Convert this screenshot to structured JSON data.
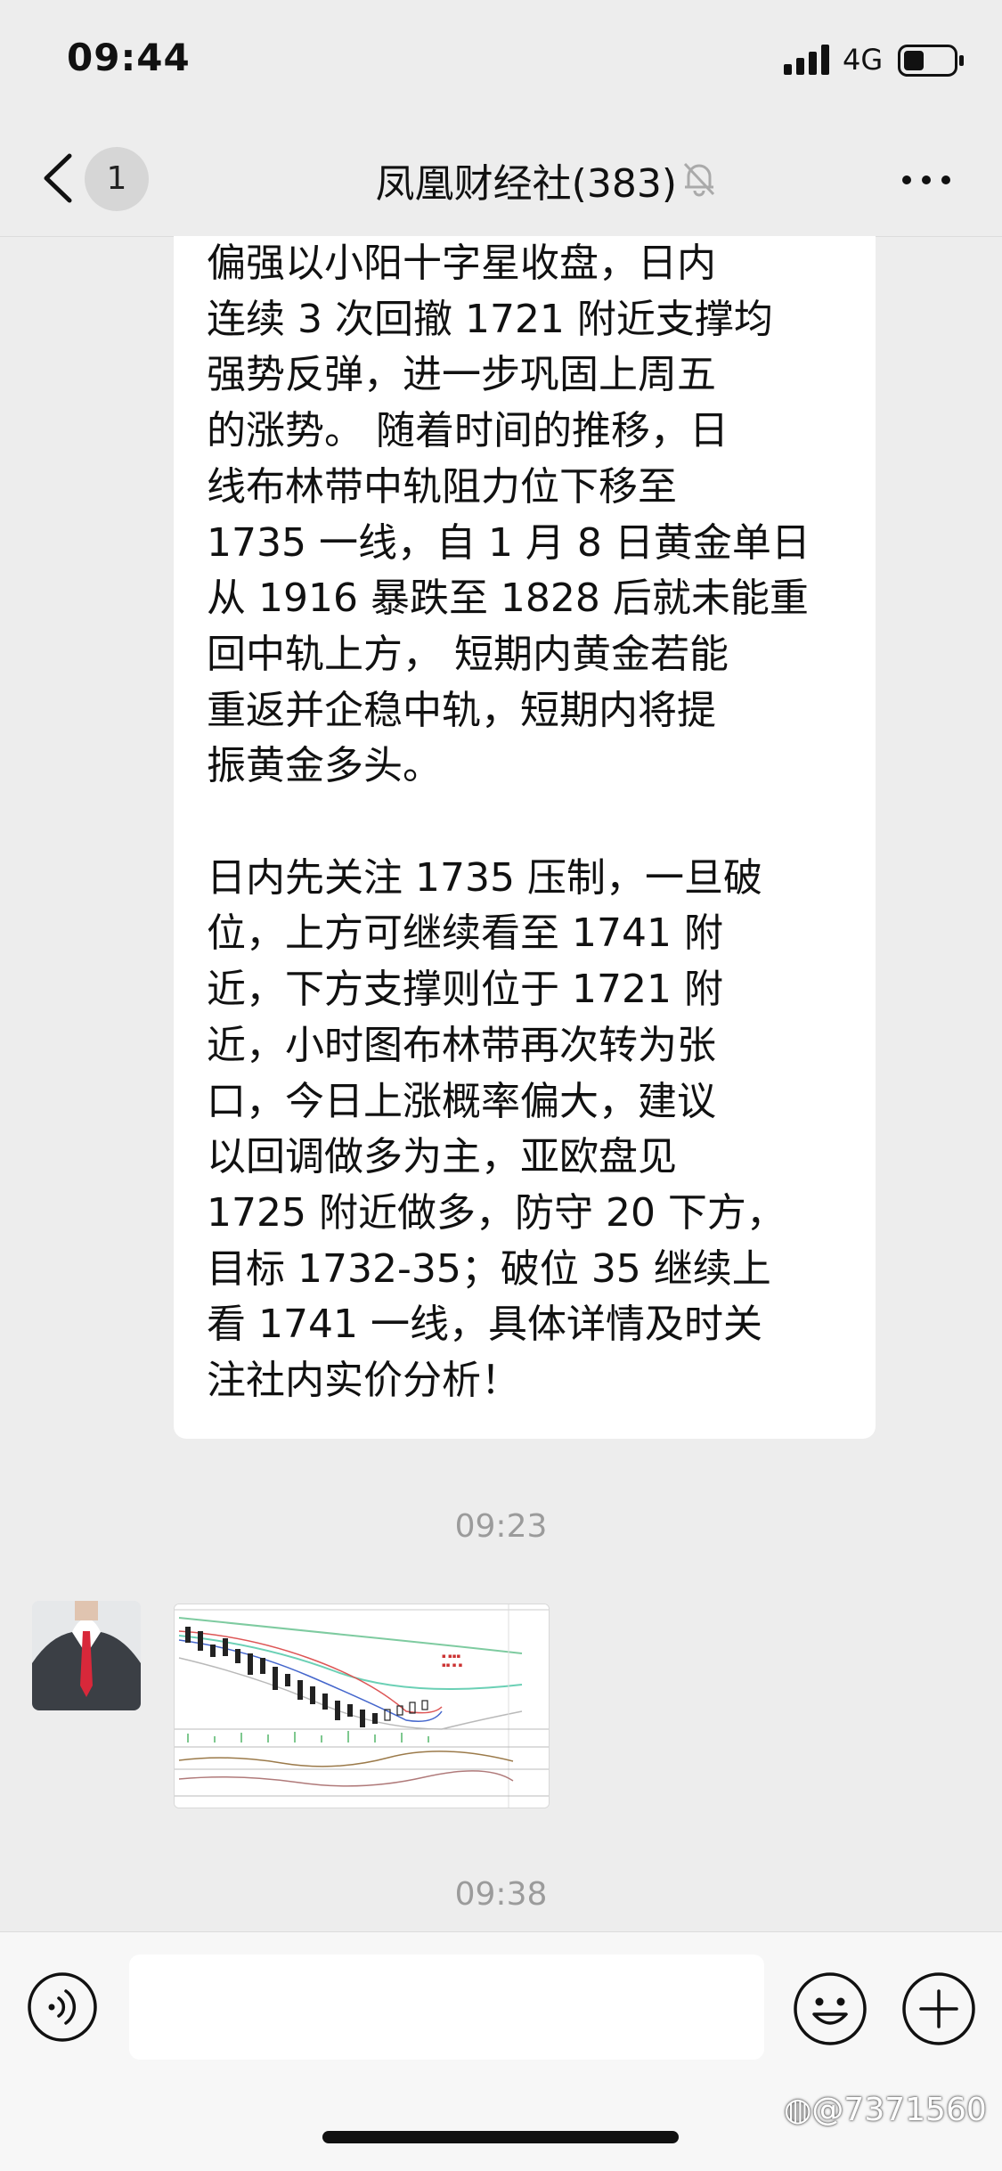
{
  "status_bar": {
    "time": "09:44",
    "network": "4G"
  },
  "nav": {
    "back_icon": "chevron-left-icon",
    "unread_count": "1",
    "title": "凤凰财经社(383)",
    "mute_icon": "bell-slash-icon",
    "more_icon": "more-dots-icon"
  },
  "messages": [
    {
      "type": "text",
      "text": "偏强以小阳十字星收盘，日内\n连续 3 次回撤 1721 附近支撑均\n强势反弹，进一步巩固上周五\n的涨势。 随着时间的推移，日\n线布林带中轨阻力位下移至\n1735 一线，自 1 月 8 日黄金单日\n从 1916 暴跌至 1828 后就未能重\n回中轨上方， 短期内黄金若能\n重返并企稳中轨，短期内将提\n振黄金多头。\n\n日内先关注 1735 压制，一旦破\n位，上方可继续看至 1741 附\n近，下方支撑则位于 1721 附\n近，小时图布林带再次转为张\n口，今日上涨概率偏大，建议\n以回调做多为主，亚欧盘见\n1725 附近做多，防守 20 下方，\n目标 1732-35；破位 35 继续上\n看 1741 一线，具体详情及时关\n注社内实价分析！"
    },
    {
      "type": "timestamp",
      "text": "09:23"
    },
    {
      "type": "image",
      "description": "candlestick-chart-thumbnail"
    },
    {
      "type": "timestamp",
      "text": "09:38"
    }
  ],
  "input_bar": {
    "voice_icon": "voice-icon",
    "emoji_icon": "emoji-icon",
    "plus_icon": "plus-circle-icon",
    "input_value": ""
  },
  "watermark": "@7371560",
  "colors": {
    "background": "#ededed",
    "bubble": "#ffffff",
    "timestamp": "#9b9b9b",
    "input_bar": "#f7f7f7"
  }
}
